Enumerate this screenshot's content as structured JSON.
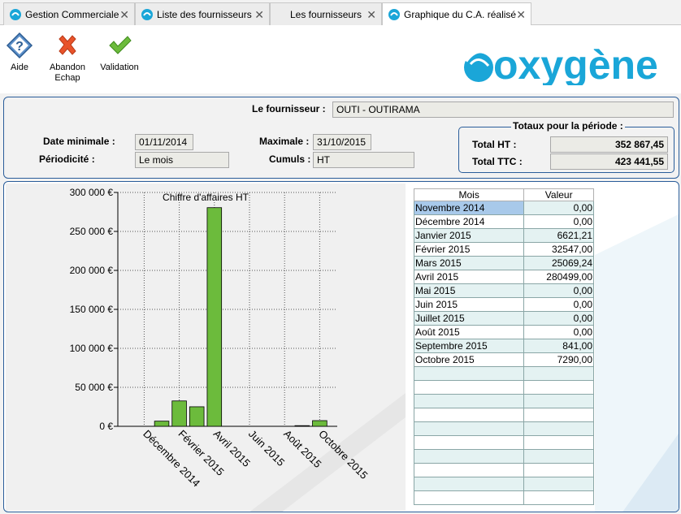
{
  "tabs": [
    {
      "label": "Gestion Commerciale"
    },
    {
      "label": "Liste des fournisseurs"
    },
    {
      "label": "Les fournisseurs"
    },
    {
      "label": "Graphique du C.A. réalisé"
    }
  ],
  "toolbar": {
    "help_label": "Aide",
    "cancel_label_1": "Abandon",
    "cancel_label_2": "Echap",
    "validate_label": "Validation"
  },
  "logo_text": "oxygène",
  "filter": {
    "supplier_label": "Le fournisseur :",
    "supplier_value": "OUTI - OUTIRAMA",
    "min_date_label": "Date minimale :",
    "min_date_value": "01/11/2014",
    "max_date_label": "Maximale :",
    "max_date_value": "31/10/2015",
    "period_label": "Périodicité :",
    "period_value": "Le mois",
    "cumul_label": "Cumuls :",
    "cumul_value": "HT",
    "totals_title": "Totaux pour la période :",
    "total_ht_label": "Total HT :",
    "total_ht_value": "352 867,45",
    "total_ttc_label": "Total TTC :",
    "total_ttc_value": "423 441,55"
  },
  "table": {
    "col_month": "Mois",
    "col_value": "Valeur",
    "rows": [
      {
        "mois": "Novembre 2014",
        "valeur": "0,00"
      },
      {
        "mois": "Décembre 2014",
        "valeur": "0,00"
      },
      {
        "mois": "Janvier 2015",
        "valeur": "6621,21"
      },
      {
        "mois": "Février 2015",
        "valeur": "32547,00"
      },
      {
        "mois": "Mars 2015",
        "valeur": "25069,24"
      },
      {
        "mois": "Avril 2015",
        "valeur": "280499,00"
      },
      {
        "mois": "Mai 2015",
        "valeur": "0,00"
      },
      {
        "mois": "Juin 2015",
        "valeur": "0,00"
      },
      {
        "mois": "Juillet 2015",
        "valeur": "0,00"
      },
      {
        "mois": "Août 2015",
        "valeur": "0,00"
      },
      {
        "mois": "Septembre 2015",
        "valeur": "841,00"
      },
      {
        "mois": "Octobre 2015",
        "valeur": "7290,00"
      }
    ]
  },
  "chart_data": {
    "type": "bar",
    "title": "Chiffre d'affaires HT",
    "categories": [
      "Novembre 2014",
      "Décembre 2014",
      "Janvier 2015",
      "Février 2015",
      "Mars 2015",
      "Avril 2015",
      "Mai 2015",
      "Juin 2015",
      "Juillet 2015",
      "Août 2015",
      "Septembre 2015",
      "Octobre 2015"
    ],
    "values": [
      0,
      0,
      6621.21,
      32547,
      25069.24,
      280499,
      0,
      0,
      0,
      0,
      841,
      7290
    ],
    "xtick_labels": [
      "",
      "Décembre 2014",
      "",
      "Février 2015",
      "",
      "Avril 2015",
      "",
      "Juin 2015",
      "",
      "Août 2015",
      "",
      "Octobre 2015"
    ],
    "yticks": [
      {
        "value": 0,
        "label": "0 €"
      },
      {
        "value": 50000,
        "label": "50 000 €"
      },
      {
        "value": 100000,
        "label": "100 000 €"
      },
      {
        "value": 150000,
        "label": "150 000 €"
      },
      {
        "value": 200000,
        "label": "200 000 €"
      },
      {
        "value": 250000,
        "label": "250 000 €"
      },
      {
        "value": 300000,
        "label": "300 000 €"
      }
    ],
    "ylim": [
      0,
      300000
    ],
    "bar_color": "#6cbb3c",
    "grid": true
  }
}
